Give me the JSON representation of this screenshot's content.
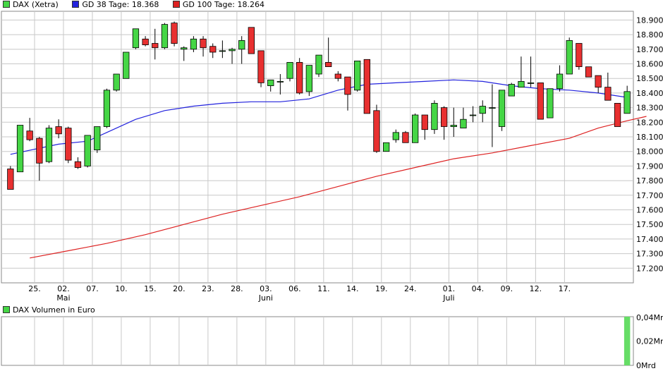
{
  "legend": {
    "dax": {
      "label": "DAX (Xetra)",
      "color": "#45d645"
    },
    "gd38": {
      "label": "GD 38 Tage: 18.368",
      "color": "#2222dd"
    },
    "gd100": {
      "label": "GD 100 Tage: 18.264",
      "color": "#dd2222"
    }
  },
  "volume_legend": {
    "label": "DAX Volumen in Euro",
    "color": "#45d645"
  },
  "colors": {
    "up": "#45d645",
    "down": "#e83030",
    "ma38": "#2222dd",
    "ma100": "#dd2222",
    "grid": "#c8c8c8",
    "volume": "#66dd66"
  },
  "chart_data": [
    {
      "type": "candlestick",
      "x_tick_labels": [
        {
          "label": "25.",
          "sub": ""
        },
        {
          "label": "02.",
          "sub": "Mai"
        },
        {
          "label": "07.",
          "sub": ""
        },
        {
          "label": "10.",
          "sub": ""
        },
        {
          "label": "15.",
          "sub": ""
        },
        {
          "label": "20.",
          "sub": ""
        },
        {
          "label": "23.",
          "sub": ""
        },
        {
          "label": "28.",
          "sub": ""
        },
        {
          "label": "03.",
          "sub": "Juni"
        },
        {
          "label": "06.",
          "sub": ""
        },
        {
          "label": "11.",
          "sub": ""
        },
        {
          "label": "14.",
          "sub": ""
        },
        {
          "label": "19.",
          "sub": ""
        },
        {
          "label": "24.",
          "sub": ""
        },
        {
          "label": "01.",
          "sub": "Juli"
        },
        {
          "label": "04.",
          "sub": ""
        },
        {
          "label": "09.",
          "sub": ""
        },
        {
          "label": "12.",
          "sub": ""
        },
        {
          "label": "17.",
          "sub": ""
        }
      ],
      "tick_index": [
        2.5,
        5.5,
        8.5,
        11.5,
        14.5,
        17.5,
        20.5,
        23.5,
        26.5,
        29.5,
        32.5,
        35.5,
        38.5,
        41.5,
        45.5,
        48.5,
        51.5,
        54.5,
        57.5
      ],
      "y_ticks": [
        "17.200",
        "17.300",
        "17.400",
        "17.500",
        "17.600",
        "17.700",
        "17.800",
        "17.900",
        "18.000",
        "18.100",
        "18.200",
        "18.300",
        "18.400",
        "18.500",
        "18.600",
        "18.700",
        "18.800",
        "18.900"
      ],
      "ylim": [
        17.1,
        18.96
      ],
      "candles": [
        [
          17.88,
          17.9,
          17.74,
          17.74
        ],
        [
          17.86,
          18.18,
          17.86,
          18.18
        ],
        [
          18.14,
          18.23,
          18.07,
          18.08
        ],
        [
          18.09,
          18.1,
          17.8,
          17.92
        ],
        [
          17.93,
          18.18,
          17.92,
          18.16
        ],
        [
          18.17,
          18.22,
          18.09,
          18.12
        ],
        [
          18.16,
          18.17,
          17.92,
          17.94
        ],
        [
          17.93,
          17.96,
          17.88,
          17.89
        ],
        [
          17.9,
          18.11,
          17.89,
          18.11
        ],
        [
          18.01,
          18.17,
          17.99,
          18.17
        ],
        [
          18.17,
          18.43,
          18.16,
          18.42
        ],
        [
          18.42,
          18.53,
          18.41,
          18.53
        ],
        [
          18.5,
          18.68,
          18.5,
          18.68
        ],
        [
          18.71,
          18.84,
          18.7,
          18.84
        ],
        [
          18.77,
          18.79,
          18.72,
          18.73
        ],
        [
          18.74,
          18.84,
          18.63,
          18.71
        ],
        [
          18.71,
          18.88,
          18.7,
          18.87
        ],
        [
          18.88,
          18.89,
          18.72,
          18.74
        ],
        [
          18.7,
          18.72,
          18.62,
          18.71
        ],
        [
          18.7,
          18.79,
          18.68,
          18.77
        ],
        [
          18.77,
          18.79,
          18.65,
          18.71
        ],
        [
          18.72,
          18.74,
          18.64,
          18.68
        ],
        [
          18.69,
          18.76,
          18.64,
          18.69
        ],
        [
          18.69,
          18.71,
          18.6,
          18.7
        ],
        [
          18.7,
          18.79,
          18.6,
          18.76
        ],
        [
          18.85,
          18.85,
          18.67,
          18.67
        ],
        [
          18.69,
          18.69,
          18.44,
          18.47
        ],
        [
          18.45,
          18.48,
          18.41,
          18.49
        ],
        [
          18.48,
          18.53,
          18.39,
          18.48
        ],
        [
          18.5,
          18.61,
          18.48,
          18.61
        ],
        [
          18.61,
          18.64,
          18.39,
          18.4
        ],
        [
          18.41,
          18.59,
          18.38,
          18.59
        ],
        [
          18.53,
          18.66,
          18.51,
          18.66
        ],
        [
          18.61,
          18.78,
          18.58,
          18.58
        ],
        [
          18.53,
          18.55,
          18.48,
          18.5
        ],
        [
          18.51,
          18.51,
          18.28,
          18.39
        ],
        [
          18.42,
          18.62,
          18.41,
          18.62
        ],
        [
          18.63,
          18.63,
          18.26,
          18.26
        ],
        [
          18.28,
          18.32,
          17.99,
          18.0
        ],
        [
          18.0,
          18.06,
          18.0,
          18.06
        ],
        [
          18.08,
          18.15,
          18.06,
          18.13
        ],
        [
          18.13,
          18.14,
          18.07,
          18.06
        ],
        [
          18.06,
          18.26,
          18.06,
          18.25
        ],
        [
          18.25,
          18.25,
          18.08,
          18.15
        ],
        [
          18.15,
          18.35,
          18.12,
          18.33
        ],
        [
          18.3,
          18.31,
          18.08,
          18.17
        ],
        [
          18.17,
          18.3,
          18.1,
          18.18
        ],
        [
          18.16,
          18.3,
          18.16,
          18.22
        ],
        [
          18.25,
          18.31,
          18.2,
          18.25
        ],
        [
          18.26,
          18.35,
          18.2,
          18.31
        ],
        [
          18.3,
          18.46,
          18.03,
          18.3
        ],
        [
          18.17,
          18.42,
          18.14,
          18.42
        ],
        [
          18.38,
          18.47,
          18.38,
          18.46
        ],
        [
          18.44,
          18.65,
          18.44,
          18.48
        ],
        [
          18.47,
          18.65,
          18.44,
          18.47
        ],
        [
          18.47,
          18.47,
          18.22,
          18.22
        ],
        [
          18.23,
          18.43,
          18.23,
          18.43
        ],
        [
          18.43,
          18.59,
          18.41,
          18.53
        ],
        [
          18.53,
          18.78,
          18.53,
          18.76
        ],
        [
          18.74,
          18.74,
          18.56,
          18.58
        ],
        [
          18.58,
          18.58,
          18.51,
          18.51
        ],
        [
          18.52,
          18.52,
          18.4,
          18.44
        ],
        [
          18.44,
          18.54,
          18.35,
          18.35
        ],
        [
          18.33,
          18.33,
          18.17,
          18.17
        ],
        [
          18.26,
          18.45,
          18.26,
          18.41
        ]
      ],
      "ma38_points": [
        [
          0,
          17.98
        ],
        [
          5,
          18.05
        ],
        [
          8,
          18.07
        ],
        [
          10,
          18.13
        ],
        [
          13,
          18.22
        ],
        [
          16,
          18.28
        ],
        [
          19,
          18.31
        ],
        [
          22,
          18.33
        ],
        [
          25,
          18.34
        ],
        [
          28,
          18.34
        ],
        [
          31,
          18.36
        ],
        [
          34,
          18.42
        ],
        [
          37,
          18.46
        ],
        [
          40,
          18.47
        ],
        [
          43,
          18.48
        ],
        [
          46,
          18.49
        ],
        [
          49,
          18.48
        ],
        [
          52,
          18.45
        ],
        [
          55,
          18.43
        ],
        [
          58,
          18.42
        ],
        [
          61,
          18.4
        ],
        [
          64,
          18.37
        ]
      ],
      "ma100_points": [
        [
          2,
          17.27
        ],
        [
          6,
          17.32
        ],
        [
          10,
          17.37
        ],
        [
          14,
          17.43
        ],
        [
          18,
          17.5
        ],
        [
          22,
          17.57
        ],
        [
          26,
          17.63
        ],
        [
          30,
          17.69
        ],
        [
          34,
          17.76
        ],
        [
          38,
          17.83
        ],
        [
          42,
          17.89
        ],
        [
          46,
          17.95
        ],
        [
          50,
          17.99
        ],
        [
          54,
          18.04
        ],
        [
          58,
          18.09
        ],
        [
          61,
          18.16
        ],
        [
          64,
          18.21
        ],
        [
          66,
          18.24
        ]
      ]
    },
    {
      "type": "bar",
      "title": "DAX Volumen in Euro",
      "y_ticks": [
        "0,04Mrd",
        "0,02Mrd",
        "0Mrd"
      ],
      "ylim": [
        0,
        0.04
      ],
      "values_index": [
        64
      ],
      "values": [
        0.04
      ]
    }
  ]
}
